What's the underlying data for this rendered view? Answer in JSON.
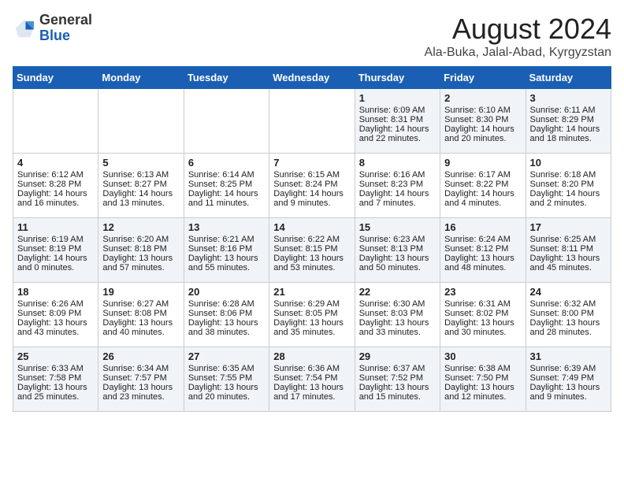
{
  "logo": {
    "general": "General",
    "blue": "Blue"
  },
  "title": {
    "month_year": "August 2024",
    "location": "Ala-Buka, Jalal-Abad, Kyrgyzstan"
  },
  "days_header": [
    "Sunday",
    "Monday",
    "Tuesday",
    "Wednesday",
    "Thursday",
    "Friday",
    "Saturday"
  ],
  "weeks": [
    [
      {
        "day": "",
        "content": ""
      },
      {
        "day": "",
        "content": ""
      },
      {
        "day": "",
        "content": ""
      },
      {
        "day": "",
        "content": ""
      },
      {
        "day": "1",
        "content": "Sunrise: 6:09 AM\nSunset: 8:31 PM\nDaylight: 14 hours and 22 minutes."
      },
      {
        "day": "2",
        "content": "Sunrise: 6:10 AM\nSunset: 8:30 PM\nDaylight: 14 hours and 20 minutes."
      },
      {
        "day": "3",
        "content": "Sunrise: 6:11 AM\nSunset: 8:29 PM\nDaylight: 14 hours and 18 minutes."
      }
    ],
    [
      {
        "day": "4",
        "content": "Sunrise: 6:12 AM\nSunset: 8:28 PM\nDaylight: 14 hours and 16 minutes."
      },
      {
        "day": "5",
        "content": "Sunrise: 6:13 AM\nSunset: 8:27 PM\nDaylight: 14 hours and 13 minutes."
      },
      {
        "day": "6",
        "content": "Sunrise: 6:14 AM\nSunset: 8:25 PM\nDaylight: 14 hours and 11 minutes."
      },
      {
        "day": "7",
        "content": "Sunrise: 6:15 AM\nSunset: 8:24 PM\nDaylight: 14 hours and 9 minutes."
      },
      {
        "day": "8",
        "content": "Sunrise: 6:16 AM\nSunset: 8:23 PM\nDaylight: 14 hours and 7 minutes."
      },
      {
        "day": "9",
        "content": "Sunrise: 6:17 AM\nSunset: 8:22 PM\nDaylight: 14 hours and 4 minutes."
      },
      {
        "day": "10",
        "content": "Sunrise: 6:18 AM\nSunset: 8:20 PM\nDaylight: 14 hours and 2 minutes."
      }
    ],
    [
      {
        "day": "11",
        "content": "Sunrise: 6:19 AM\nSunset: 8:19 PM\nDaylight: 14 hours and 0 minutes."
      },
      {
        "day": "12",
        "content": "Sunrise: 6:20 AM\nSunset: 8:18 PM\nDaylight: 13 hours and 57 minutes."
      },
      {
        "day": "13",
        "content": "Sunrise: 6:21 AM\nSunset: 8:16 PM\nDaylight: 13 hours and 55 minutes."
      },
      {
        "day": "14",
        "content": "Sunrise: 6:22 AM\nSunset: 8:15 PM\nDaylight: 13 hours and 53 minutes."
      },
      {
        "day": "15",
        "content": "Sunrise: 6:23 AM\nSunset: 8:13 PM\nDaylight: 13 hours and 50 minutes."
      },
      {
        "day": "16",
        "content": "Sunrise: 6:24 AM\nSunset: 8:12 PM\nDaylight: 13 hours and 48 minutes."
      },
      {
        "day": "17",
        "content": "Sunrise: 6:25 AM\nSunset: 8:11 PM\nDaylight: 13 hours and 45 minutes."
      }
    ],
    [
      {
        "day": "18",
        "content": "Sunrise: 6:26 AM\nSunset: 8:09 PM\nDaylight: 13 hours and 43 minutes."
      },
      {
        "day": "19",
        "content": "Sunrise: 6:27 AM\nSunset: 8:08 PM\nDaylight: 13 hours and 40 minutes."
      },
      {
        "day": "20",
        "content": "Sunrise: 6:28 AM\nSunset: 8:06 PM\nDaylight: 13 hours and 38 minutes."
      },
      {
        "day": "21",
        "content": "Sunrise: 6:29 AM\nSunset: 8:05 PM\nDaylight: 13 hours and 35 minutes."
      },
      {
        "day": "22",
        "content": "Sunrise: 6:30 AM\nSunset: 8:03 PM\nDaylight: 13 hours and 33 minutes."
      },
      {
        "day": "23",
        "content": "Sunrise: 6:31 AM\nSunset: 8:02 PM\nDaylight: 13 hours and 30 minutes."
      },
      {
        "day": "24",
        "content": "Sunrise: 6:32 AM\nSunset: 8:00 PM\nDaylight: 13 hours and 28 minutes."
      }
    ],
    [
      {
        "day": "25",
        "content": "Sunrise: 6:33 AM\nSunset: 7:58 PM\nDaylight: 13 hours and 25 minutes."
      },
      {
        "day": "26",
        "content": "Sunrise: 6:34 AM\nSunset: 7:57 PM\nDaylight: 13 hours and 23 minutes."
      },
      {
        "day": "27",
        "content": "Sunrise: 6:35 AM\nSunset: 7:55 PM\nDaylight: 13 hours and 20 minutes."
      },
      {
        "day": "28",
        "content": "Sunrise: 6:36 AM\nSunset: 7:54 PM\nDaylight: 13 hours and 17 minutes."
      },
      {
        "day": "29",
        "content": "Sunrise: 6:37 AM\nSunset: 7:52 PM\nDaylight: 13 hours and 15 minutes."
      },
      {
        "day": "30",
        "content": "Sunrise: 6:38 AM\nSunset: 7:50 PM\nDaylight: 13 hours and 12 minutes."
      },
      {
        "day": "31",
        "content": "Sunrise: 6:39 AM\nSunset: 7:49 PM\nDaylight: 13 hours and 9 minutes."
      }
    ]
  ]
}
